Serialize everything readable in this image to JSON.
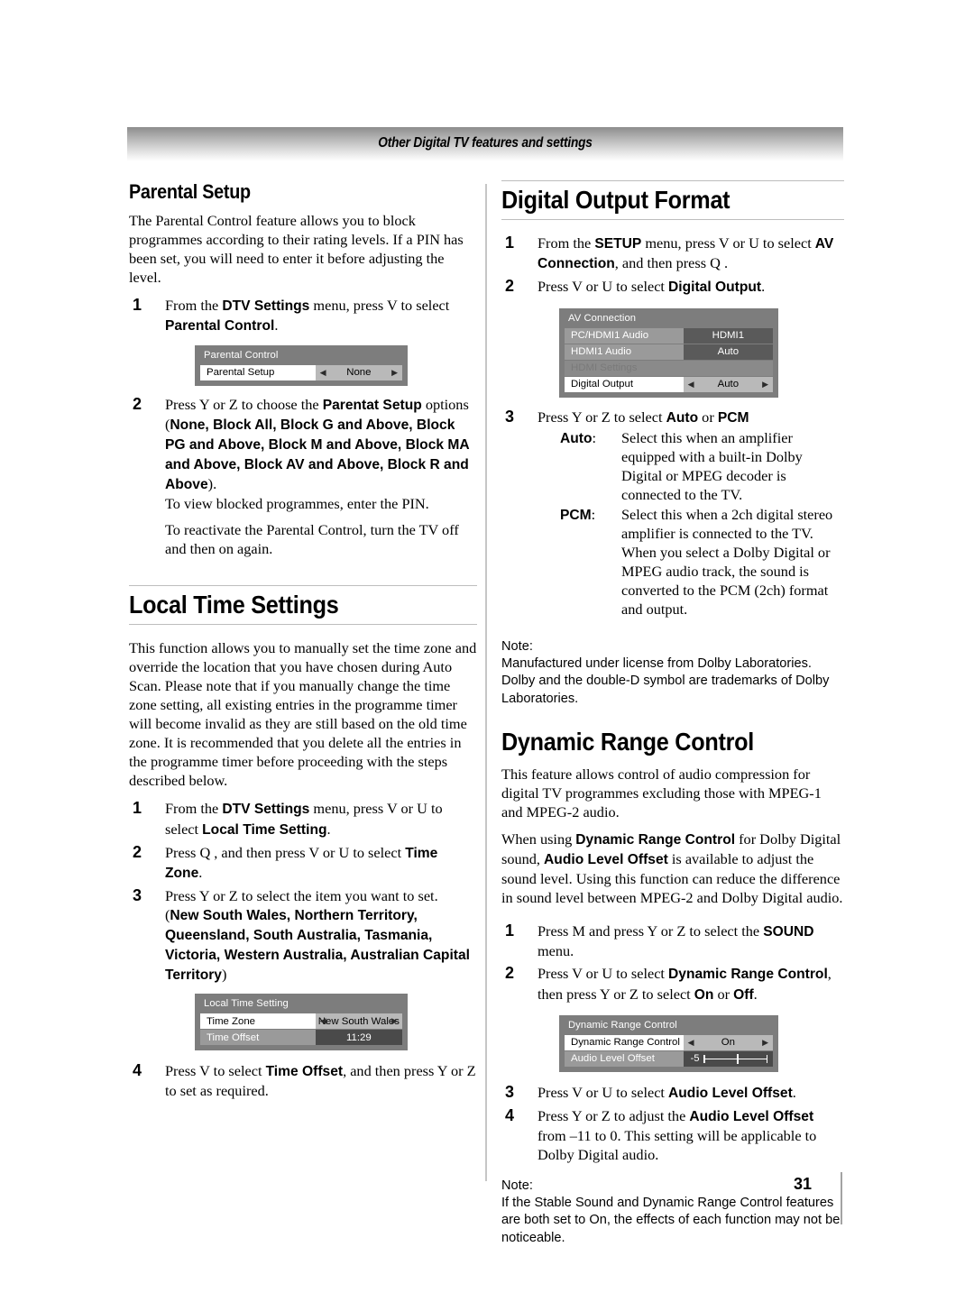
{
  "header": {
    "running_title": "Other Digital TV features and settings"
  },
  "folio": {
    "page_number": "31"
  },
  "left_column": {
    "parental": {
      "heading": "Parental Setup",
      "intro": "The Parental Control feature allows you to block programmes according to their rating levels. If a PIN has been set, you will need to enter it before adjusting the level.",
      "step1": {
        "num": "1",
        "t1": "From the ",
        "b1": "DTV Settings",
        "t2": " menu, press  V to select ",
        "b2": "Parental Control",
        "t3": "."
      },
      "osd": {
        "title": "Parental Control",
        "rows": [
          {
            "label": "Parental Setup",
            "value": "None",
            "arrows": true
          }
        ]
      },
      "step2": {
        "num": "2",
        "t1": "Press  Y or  Z to choose the ",
        "b1": "Parentat Setup",
        "t2": " options",
        "options_open": "(",
        "options": "None, Block All, Block G and Above, Block PG and Above, Block M and Above, Block MA and Above, Block AV and Above, Block R and Above",
        "options_close": ").",
        "note1": "To view blocked programmes, enter the PIN.",
        "note2": "To reactivate the Parental Control, turn the TV off and then on again."
      }
    },
    "local_time": {
      "heading": "Local Time Settings",
      "intro": "This function allows you to manually set the time zone and override the location that you have chosen during Auto Scan. Please note that if you manually change the time zone setting, all existing entries in the programme timer will become invalid as they are still based on the old time zone. It is recommended that you delete all the entries in the programme timer before proceeding with the steps described below.",
      "step1": {
        "num": "1",
        "t1": "From the ",
        "b1": "DTV Settings",
        "t2": " menu, press  V or  U to select ",
        "b2": "Local Time Setting",
        "t3": "."
      },
      "step2": {
        "num": "2",
        "t1": "Press Q  , and then press  V or  U to select ",
        "b1": "Time Zone",
        "t2": "."
      },
      "step3": {
        "num": "3",
        "t1": "Press  Y or  Z to select the item you want to set.",
        "options_open": "(",
        "options": "New South Wales, Northern Territory, Queensland, South Australia, Tasmania, Victoria, Western Australia, Australian Capital Territory",
        "options_close": ")"
      },
      "osd": {
        "title": "Local Time Setting",
        "rows": [
          {
            "label": "Time Zone",
            "value": "New South Wales",
            "arrows": true
          },
          {
            "label": "Time Offset",
            "value": "11:29",
            "arrows": false
          }
        ]
      },
      "step4": {
        "num": "4",
        "t1": "Press  V to select ",
        "b1": "Time Offset",
        "t2": ", and then press  Y or  Z to set as required."
      }
    }
  },
  "right_column": {
    "digital_output": {
      "heading": "Digital Output Format",
      "step1": {
        "num": "1",
        "t1": "From the ",
        "b1": "SETUP",
        "t2": " menu, press  V or  U to select ",
        "b2": "AV Connection",
        "t3": ", and then press Q  ."
      },
      "step2": {
        "num": "2",
        "t1": "Press  V or  U to select ",
        "b1": "Digital Output",
        "t2": "."
      },
      "osd": {
        "title": "AV Connection",
        "rows": [
          {
            "label": "PC/HDMI1 Audio",
            "value": "HDMI1",
            "state": "norm"
          },
          {
            "label": "HDMI1 Audio",
            "value": "Auto",
            "state": "norm"
          },
          {
            "label": "HDMI Settings",
            "value": "",
            "state": "dis"
          },
          {
            "label": "Digital Output",
            "value": "Auto",
            "state": "sel"
          }
        ]
      },
      "step3": {
        "num": "3",
        "t1": "Press  Y or  Z to select ",
        "b1": "Auto",
        "t2": " or ",
        "b2": "PCM",
        "defs": [
          {
            "term": "Auto",
            "text": "Select this when an amplifier equipped with a built-in Dolby Digital or MPEG decoder is connected to the TV."
          },
          {
            "term": "PCM",
            "text": "Select this when a 2ch digital stereo amplifier is connected to the TV. When you select a Dolby Digital or MPEG audio track, the sound is converted to the PCM (2ch) format and output."
          }
        ]
      },
      "note": {
        "label": "Note:",
        "text": "Manufactured under license from Dolby Laboratories.  Dolby and the double-D symbol are trademarks of Dolby Laboratories."
      }
    },
    "drc": {
      "heading": "Dynamic Range Control",
      "intro": "This feature allows control of audio compression for digital TV programmes excluding those with MPEG-1 and MPEG-2 audio.",
      "para2": {
        "t1": "When using ",
        "b1": "Dynamic Range Control",
        "t2": " for Dolby Digital sound, ",
        "b2": "Audio Level Offset",
        "t3": " is available to adjust the sound level. Using this function can reduce the difference in sound level between MPEG-2 and Dolby Digital audio."
      },
      "step1": {
        "num": "1",
        "t1": "Press M  and press  Y or  Z to select the ",
        "b1": "SOUND",
        "t2": " menu."
      },
      "step2": {
        "num": "2",
        "t1": "Press  V or  U to select ",
        "b1": "Dynamic Range Control",
        "t2": ", then press  Y or  Z to select ",
        "b2": "On",
        "t3": " or ",
        "b3": "Off",
        "t4": "."
      },
      "osd": {
        "title": "Dynamic Range Control",
        "rows": [
          {
            "label": "Dynamic Range Control",
            "value": "On",
            "arrows": true
          },
          {
            "label": "Audio Level Offset",
            "value": "-5",
            "slider": true
          }
        ]
      },
      "step3": {
        "num": "3",
        "t1": "Press  V or  U to select ",
        "b1": "Audio Level Offset",
        "t2": "."
      },
      "step4": {
        "num": "4",
        "t1": "Press  Y or  Z to adjust the ",
        "b1": "Audio Level Offset",
        "t2": " from –11 to 0. This setting will be applicable to Dolby Digital audio."
      },
      "note": {
        "label": "Note:",
        "text": "If the Stable Sound  and Dynamic Range Control   features are both set to On, the effects of each function may not be noticeable."
      }
    }
  }
}
